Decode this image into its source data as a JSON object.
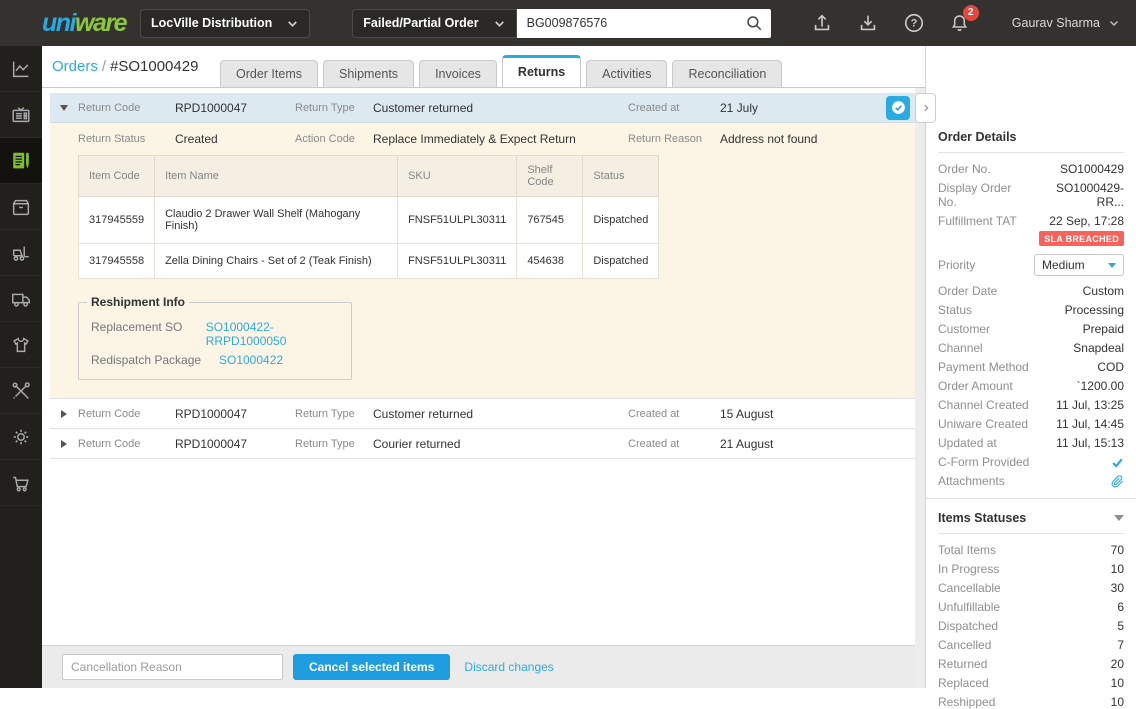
{
  "topbar": {
    "logo_part1": "uni",
    "logo_part2": "ware",
    "facility_selector": "LocVille Distribution",
    "search_filter": "Failed/Partial Order",
    "search_value": "BG009876576",
    "notification_count": "2",
    "user_name": "Gaurav Sharma"
  },
  "sidebar": {
    "icons": [
      "analytics",
      "channels",
      "orders",
      "inventory",
      "fulfillment",
      "dispatch",
      "products",
      "tools",
      "settings",
      "purchase"
    ],
    "active_item": "orders"
  },
  "breadcrumb": {
    "link": "Orders",
    "separator": "/",
    "current": "#SO1000429"
  },
  "tabs": [
    {
      "label": "Order Items"
    },
    {
      "label": "Shipments"
    },
    {
      "label": "Invoices"
    },
    {
      "label": "Returns",
      "active": true
    },
    {
      "label": "Activities"
    },
    {
      "label": "Reconciliation"
    }
  ],
  "labels": {
    "return_code": "Return Code",
    "return_type": "Return Type",
    "created_at": "Created at",
    "return_status": "Return Status",
    "action_code": "Action Code",
    "return_reason": "Return Reason"
  },
  "returns": [
    {
      "code": "RPD1000047",
      "type": "Customer returned",
      "created_at": "21 July",
      "status": "Created",
      "action_code": "Replace Immediately & Expect Return",
      "reason": "Address not found",
      "items": {
        "headers": [
          "Item Code",
          "Item Name",
          "SKU",
          "Shelf Code",
          "Status"
        ],
        "rows": [
          [
            "317945559",
            "Claudio 2 Drawer Wall Shelf (Mahogany Finish)",
            "FNSF51ULPL30311",
            "767545",
            "Dispatched"
          ],
          [
            "317945558",
            "Zella Dining Chairs - Set of 2 (Teak Finish)",
            "FNSF51ULPL30311",
            "454638",
            "Dispatched"
          ]
        ]
      },
      "reshipment": {
        "title": "Reshipment Info",
        "replacement_so_label": "Replacement SO",
        "replacement_so": "SO1000422-RRPD1000050",
        "redispatch_package_label": "Redispatch Package",
        "redispatch_package": "SO1000422"
      }
    },
    {
      "code": "RPD1000047",
      "type": "Customer returned",
      "created_at": "15 August"
    },
    {
      "code": "RPD1000047",
      "type": "Courier returned",
      "created_at": "21 August"
    }
  ],
  "footer": {
    "cancellation_placeholder": "Cancellation Reason",
    "cancel_button": "Cancel selected items",
    "discard_link": "Discard changes"
  },
  "order_details": {
    "title": "Order Details",
    "fields": [
      {
        "label": "Order No.",
        "value": "SO1000429"
      },
      {
        "label": "Display Order No.",
        "value": "SO1000429-RR..."
      },
      {
        "label": "Fulfillment TAT",
        "value": "22 Sep, 17:28",
        "badge": "SLA BREACHED"
      },
      {
        "label": "Priority",
        "value": "Medium"
      },
      {
        "label": "Order Date",
        "value": "Custom"
      },
      {
        "label": "Status",
        "value": "Processing"
      },
      {
        "label": "Customer",
        "value": "Prepaid"
      },
      {
        "label": "Channel",
        "value": "Snapdeal"
      },
      {
        "label": "Payment Method",
        "value": "COD"
      },
      {
        "label": "Order Amount",
        "value": "`1200.00"
      },
      {
        "label": "Channel Created",
        "value": "11 Jul, 13:25"
      },
      {
        "label": "Uniware Created",
        "value": "11 Jul, 14:45"
      },
      {
        "label": "Updated at",
        "value": "11 Jul, 15:13"
      },
      {
        "label": "C-Form Provided",
        "value": ""
      },
      {
        "label": "Attachments",
        "value": ""
      }
    ]
  },
  "items_statuses": {
    "title": "Items Statuses",
    "rows": [
      {
        "label": "Total Items",
        "value": "70"
      },
      {
        "label": "In Progress",
        "value": "10"
      },
      {
        "label": "Cancellable",
        "value": "30"
      },
      {
        "label": "Unfulfillable",
        "value": "6"
      },
      {
        "label": "Dispatched",
        "value": "5"
      },
      {
        "label": "Cancelled",
        "value": "7"
      },
      {
        "label": "Returned",
        "value": "20"
      },
      {
        "label": "Replaced",
        "value": "10"
      },
      {
        "label": "Reshipped",
        "value": "10"
      }
    ]
  },
  "colors": {
    "accent_blue": "#29abe2",
    "brand_green": "#8dc63f",
    "alert_red": "#f9625a",
    "notification_red": "#e8463c",
    "cream_bg": "#fcf5e6",
    "header_blue_gray": "#dde9f0",
    "topbar_dark": "#34322f"
  }
}
